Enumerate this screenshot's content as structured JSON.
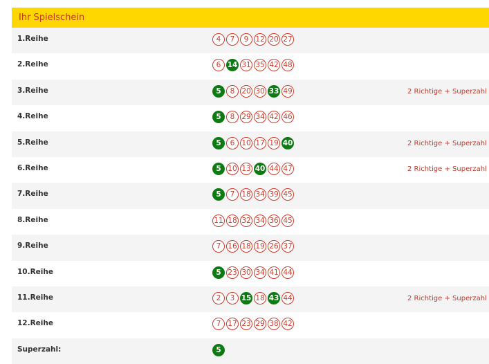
{
  "header": {
    "title": "Ihr Spielschein"
  },
  "rows": [
    {
      "label": "1.Reihe",
      "numbers": [
        4,
        7,
        9,
        12,
        20,
        27
      ],
      "hits": [],
      "result": ""
    },
    {
      "label": "2.Reihe",
      "numbers": [
        6,
        14,
        31,
        35,
        42,
        48
      ],
      "hits": [
        14
      ],
      "result": ""
    },
    {
      "label": "3.Reihe",
      "numbers": [
        5,
        8,
        20,
        30,
        33,
        49
      ],
      "hits": [
        5,
        33
      ],
      "result": "2 Richtige + Superzahl"
    },
    {
      "label": "4.Reihe",
      "numbers": [
        5,
        8,
        29,
        34,
        42,
        46
      ],
      "hits": [
        5
      ],
      "result": ""
    },
    {
      "label": "5.Reihe",
      "numbers": [
        5,
        6,
        10,
        17,
        19,
        40
      ],
      "hits": [
        5,
        40
      ],
      "result": "2 Richtige + Superzahl"
    },
    {
      "label": "6.Reihe",
      "numbers": [
        5,
        10,
        13,
        40,
        44,
        47
      ],
      "hits": [
        5,
        40
      ],
      "result": "2 Richtige + Superzahl"
    },
    {
      "label": "7.Reihe",
      "numbers": [
        5,
        7,
        18,
        34,
        39,
        45
      ],
      "hits": [
        5
      ],
      "result": ""
    },
    {
      "label": "8.Reihe",
      "numbers": [
        11,
        18,
        32,
        34,
        36,
        45
      ],
      "hits": [],
      "result": ""
    },
    {
      "label": "9.Reihe",
      "numbers": [
        7,
        16,
        18,
        19,
        26,
        37
      ],
      "hits": [],
      "result": ""
    },
    {
      "label": "10.Reihe",
      "numbers": [
        5,
        23,
        30,
        34,
        41,
        44
      ],
      "hits": [
        5
      ],
      "result": ""
    },
    {
      "label": "11.Reihe",
      "numbers": [
        2,
        3,
        15,
        18,
        43,
        44
      ],
      "hits": [
        15,
        43
      ],
      "result": "2 Richtige + Superzahl"
    },
    {
      "label": "12.Reihe",
      "numbers": [
        7,
        17,
        23,
        29,
        38,
        42
      ],
      "hits": [],
      "result": ""
    },
    {
      "label": "Superzahl:",
      "numbers": [
        5
      ],
      "hits": [
        5
      ],
      "result": ""
    }
  ]
}
